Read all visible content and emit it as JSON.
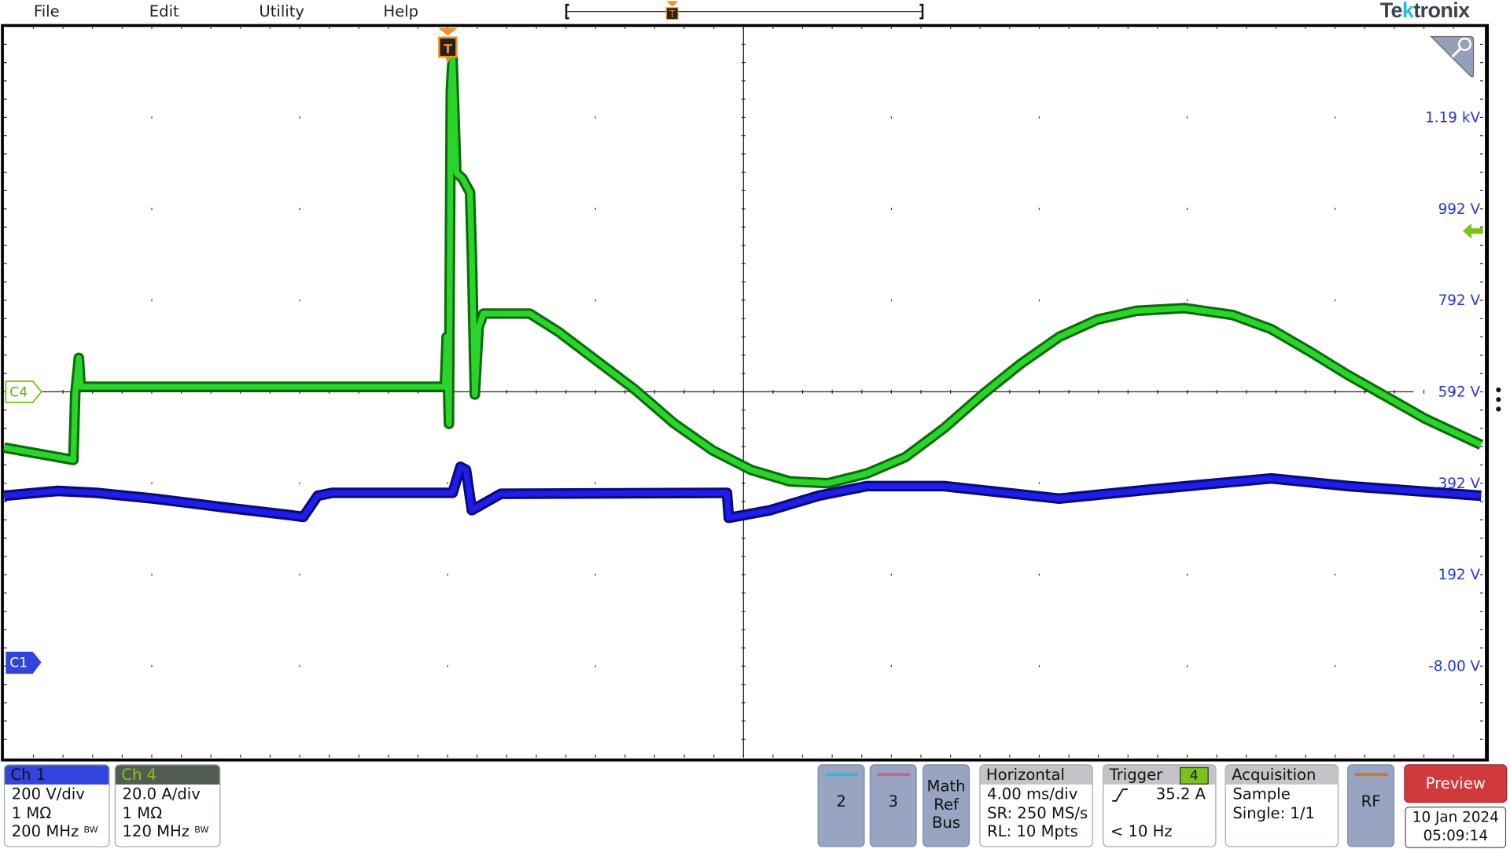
{
  "menu": {
    "items": [
      "File",
      "Edit",
      "Utility",
      "Help"
    ]
  },
  "brand": {
    "logo": "Tektronix"
  },
  "timeline": {
    "trigger_marker": "T"
  },
  "plot": {
    "trigger_marker": "T",
    "ch4_marker": "C4",
    "ch1_marker": "C1",
    "right_axis_labels": [
      "1.19 kV",
      "992 V",
      "792 V",
      "592 V",
      "392 V",
      "192 V",
      "-8.00 V"
    ],
    "zoom_icon": "magnifier-icon",
    "trigger_level_icon": "arrow-left-icon",
    "colors": {
      "ch1": "#1a1ae6",
      "ch4": "#22cc22",
      "trigger": "#f39020",
      "axis_labels": "#2a36d8"
    }
  },
  "chart_data": {
    "type": "line",
    "x_unit": "ms (relative to trigger)",
    "x_divisions": 10,
    "y_divisions": 8,
    "grid": true,
    "series": [
      {
        "name": "Ch 4",
        "unit": "A",
        "color": "#22cc22",
        "points": [
          [
            -11.97,
            -12.2
          ],
          [
            -10.1,
            -14.9
          ],
          [
            -10.05,
            -0.6
          ],
          [
            -9.95,
            7.4
          ],
          [
            -9.9,
            1.1
          ],
          [
            -0.08,
            1.1
          ],
          [
            -0.03,
            12.0
          ],
          [
            0.03,
            -7.0
          ],
          [
            0.08,
            65.7
          ],
          [
            0.13,
            73.0
          ],
          [
            0.23,
            47.8
          ],
          [
            0.39,
            46.7
          ],
          [
            0.6,
            43.6
          ],
          [
            0.65,
            29.9
          ],
          [
            0.73,
            -0.6
          ],
          [
            0.83,
            14.1
          ],
          [
            0.96,
            17.1
          ],
          [
            2.21,
            17.1
          ],
          [
            2.99,
            13.1
          ],
          [
            4.03,
            6.7
          ],
          [
            5.06,
            0.4
          ],
          [
            6.1,
            -6.9
          ],
          [
            7.14,
            -12.8
          ],
          [
            8.18,
            -17.1
          ],
          [
            9.22,
            -19.6
          ],
          [
            10.26,
            -20.0
          ],
          [
            11.3,
            -17.9
          ],
          [
            12.34,
            -14.3
          ],
          [
            13.38,
            -8.0
          ],
          [
            14.42,
            -0.6
          ],
          [
            15.45,
            6.1
          ],
          [
            16.49,
            12.0
          ],
          [
            17.53,
            15.8
          ],
          [
            18.57,
            17.7
          ],
          [
            19.87,
            18.3
          ],
          [
            21.17,
            16.8
          ],
          [
            22.21,
            13.7
          ],
          [
            23.25,
            8.8
          ],
          [
            24.29,
            3.6
          ],
          [
            25.32,
            -1.1
          ],
          [
            26.36,
            -5.9
          ],
          [
            27.87,
            -11.6
          ]
        ]
      },
      {
        "name": "Ch 1",
        "unit": "V",
        "color": "#1a1ae6",
        "points": [
          [
            -11.97,
            364.6
          ],
          [
            -10.52,
            375.1
          ],
          [
            -9.48,
            370.9
          ],
          [
            -7.92,
            358.3
          ],
          [
            -5.84,
            337.2
          ],
          [
            -4.29,
            322.5
          ],
          [
            -3.9,
            318.3
          ],
          [
            -3.51,
            364.6
          ],
          [
            -3.12,
            370.9
          ],
          [
            0.13,
            370.9
          ],
          [
            0.34,
            427.7
          ],
          [
            0.49,
            421.4
          ],
          [
            0.65,
            333.0
          ],
          [
            1.43,
            368.8
          ],
          [
            7.53,
            370.9
          ],
          [
            7.58,
            316.2
          ],
          [
            8.7,
            333.0
          ],
          [
            10.0,
            364.6
          ],
          [
            11.3,
            385.6
          ],
          [
            13.38,
            385.6
          ],
          [
            16.49,
            358.3
          ],
          [
            19.09,
            379.3
          ],
          [
            22.21,
            402.5
          ],
          [
            24.29,
            385.6
          ],
          [
            27.87,
            364.6
          ]
        ]
      }
    ]
  },
  "channels": [
    {
      "label": "Ch 1",
      "scale": "200 V/div",
      "impedance": "1 MΩ",
      "bandwidth": "200 MHz",
      "bw_badge": "BW",
      "color": "#3344dd"
    },
    {
      "label": "Ch 4",
      "scale": "20.0 A/div",
      "impedance": "1 MΩ",
      "bandwidth": "120 MHz",
      "bw_badge": "BW",
      "color": "#525c50"
    }
  ],
  "buttons": {
    "ch2": "2",
    "ch3": "3",
    "math": [
      "Math",
      "Ref",
      "Bus"
    ],
    "rf": "RF",
    "preview": "Preview"
  },
  "horizontal": {
    "title": "Horizontal",
    "scale": "4.00 ms/div",
    "sample_rate": "SR: 250 MS/s",
    "record_length": "RL: 10 Mpts"
  },
  "trigger": {
    "title": "Trigger",
    "source": "4",
    "level": "35.2 A",
    "frequency": "< 10 Hz",
    "slope_icon": "rising-edge-icon"
  },
  "acquisition": {
    "title": "Acquisition",
    "mode": "Sample",
    "single": "Single: 1/1"
  },
  "datetime": {
    "date": "10 Jan 2024",
    "time": "05:09:14"
  }
}
